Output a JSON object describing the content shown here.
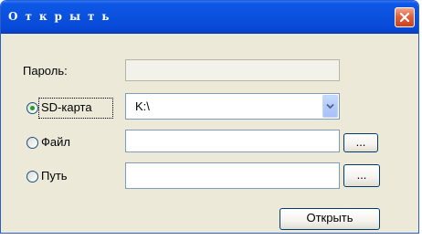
{
  "window": {
    "title": "Открыть"
  },
  "form": {
    "password_label": "Пароль:",
    "password_value": "",
    "source_options": [
      {
        "label": "SD-карта",
        "selected": true
      },
      {
        "label": "Файл",
        "selected": false
      },
      {
        "label": "Путь",
        "selected": false
      }
    ],
    "sd_drive_value": "K:\\",
    "file_value": "",
    "path_value": "",
    "browse_label": "...",
    "open_button_label": "Открыть"
  },
  "icons": {
    "close": "close-icon",
    "dropdown": "chevron-down-icon",
    "radio_selected": "radio-selected-icon"
  },
  "colors": {
    "titlebar": "#0b52dd",
    "dialog_bg": "#ece9d8",
    "close_button": "#e2603e",
    "radio_dot": "#21a121"
  }
}
